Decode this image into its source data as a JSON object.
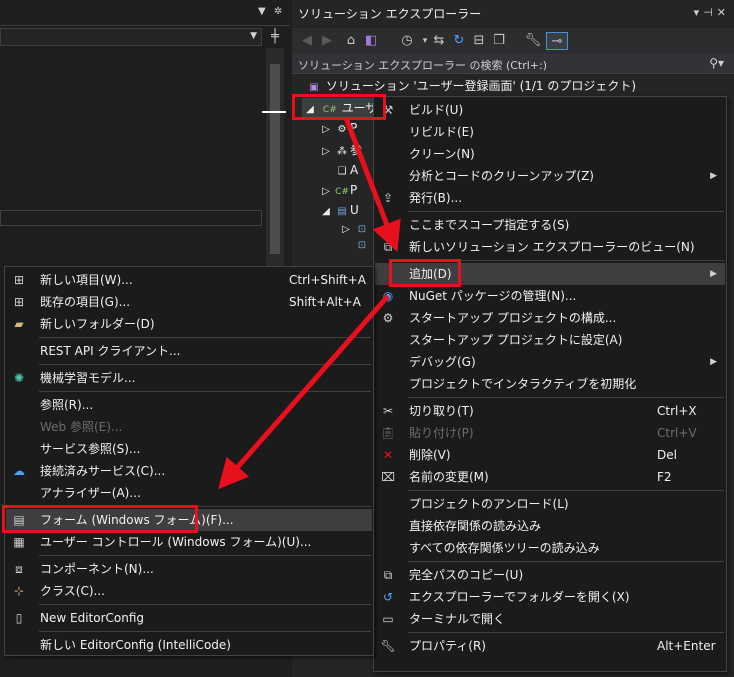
{
  "solution_explorer": {
    "title": "ソリューション エクスプローラー",
    "search_placeholder": "ソリューション エクスプローラー の検索 (Ctrl+:)",
    "solution_label": "ソリューション 'ユーザー登録画面' (1/1 のプロジェクト)",
    "project_label": "ユーザ",
    "tree_letters": [
      "P",
      "参",
      "A",
      "P",
      "U"
    ]
  },
  "context_menu": {
    "items": [
      {
        "label": "ビルド(U)",
        "key": "",
        "icon": "build-icon"
      },
      {
        "label": "リビルド(E)",
        "key": "",
        "icon": ""
      },
      {
        "label": "クリーン(N)",
        "key": "",
        "icon": ""
      },
      {
        "label": "分析とコードのクリーンアップ(Z)",
        "key": "",
        "icon": "",
        "submenu": true
      },
      {
        "label": "発行(B)...",
        "key": "",
        "icon": "publish-icon"
      },
      {
        "label": "ここまでスコープ指定する(S)",
        "key": "",
        "icon": ""
      },
      {
        "label": "新しいソリューション エクスプローラーのビュー(N)",
        "key": "",
        "icon": "new-view-icon"
      },
      {
        "label": "追加(D)",
        "key": "",
        "icon": "",
        "submenu": true
      },
      {
        "label": "NuGet パッケージの管理(N)...",
        "key": "",
        "icon": "nuget-icon"
      },
      {
        "label": "スタートアップ プロジェクトの構成...",
        "key": "",
        "icon": "gear-icon"
      },
      {
        "label": "スタートアップ プロジェクトに設定(A)",
        "key": "",
        "icon": ""
      },
      {
        "label": "デバッグ(G)",
        "key": "",
        "icon": "",
        "submenu": true
      },
      {
        "label": "プロジェクトでインタラクティブを初期化",
        "key": "",
        "icon": ""
      },
      {
        "label": "切り取り(T)",
        "key": "Ctrl+X",
        "icon": "cut-icon"
      },
      {
        "label": "貼り付け(P)",
        "key": "Ctrl+V",
        "icon": "paste-icon",
        "disabled": true
      },
      {
        "label": "削除(V)",
        "key": "Del",
        "icon": "delete-icon"
      },
      {
        "label": "名前の変更(M)",
        "key": "F2",
        "icon": "rename-icon"
      },
      {
        "label": "プロジェクトのアンロード(L)",
        "key": "",
        "icon": ""
      },
      {
        "label": "直接依存関係の読み込み",
        "key": "",
        "icon": ""
      },
      {
        "label": "すべての依存関係ツリーの読み込み",
        "key": "",
        "icon": ""
      },
      {
        "label": "完全パスのコピー(U)",
        "key": "",
        "icon": "copy-icon"
      },
      {
        "label": "エクスプローラーでフォルダーを開く(X)",
        "key": "",
        "icon": "open-folder-icon"
      },
      {
        "label": "ターミナルで開く",
        "key": "",
        "icon": "terminal-icon"
      },
      {
        "label": "プロパティ(R)",
        "key": "Alt+Enter",
        "icon": "wrench-icon"
      }
    ]
  },
  "add_submenu": {
    "items": [
      {
        "label": "新しい項目(W)...",
        "key": "Ctrl+Shift+A",
        "icon": "new-item-icon"
      },
      {
        "label": "既存の項目(G)...",
        "key": "Shift+Alt+A",
        "icon": "existing-item-icon"
      },
      {
        "label": "新しいフォルダー(D)",
        "key": "",
        "icon": "folder-icon"
      },
      {
        "label": "REST API クライアント...",
        "key": "",
        "icon": ""
      },
      {
        "label": "機械学習モデル...",
        "key": "",
        "icon": "ml-icon"
      },
      {
        "label": "参照(R)...",
        "key": "",
        "icon": ""
      },
      {
        "label": "Web 参照(E)...",
        "key": "",
        "icon": "",
        "disabled": true
      },
      {
        "label": "サービス参照(S)...",
        "key": "",
        "icon": ""
      },
      {
        "label": "接続済みサービス(C)...",
        "key": "",
        "icon": "connected-service-icon"
      },
      {
        "label": "アナライザー(A)...",
        "key": "",
        "icon": ""
      },
      {
        "label": "フォーム (Windows フォーム)(F)...",
        "key": "",
        "icon": "form-icon"
      },
      {
        "label": "ユーザー コントロール (Windows フォーム)(U)...",
        "key": "",
        "icon": "user-control-icon"
      },
      {
        "label": "コンポーネント(N)...",
        "key": "",
        "icon": "component-icon"
      },
      {
        "label": "クラス(C)...",
        "key": "",
        "icon": "class-icon"
      },
      {
        "label": "New EditorConfig",
        "key": "",
        "icon": "file-icon"
      },
      {
        "label": "新しい EditorConfig (IntelliCode)",
        "key": "",
        "icon": ""
      }
    ]
  },
  "colors": {
    "highlight": "#e8101c",
    "menu_bg": "#1b1b1c",
    "panel_bg": "#252526",
    "accent": "#4a90d9"
  }
}
